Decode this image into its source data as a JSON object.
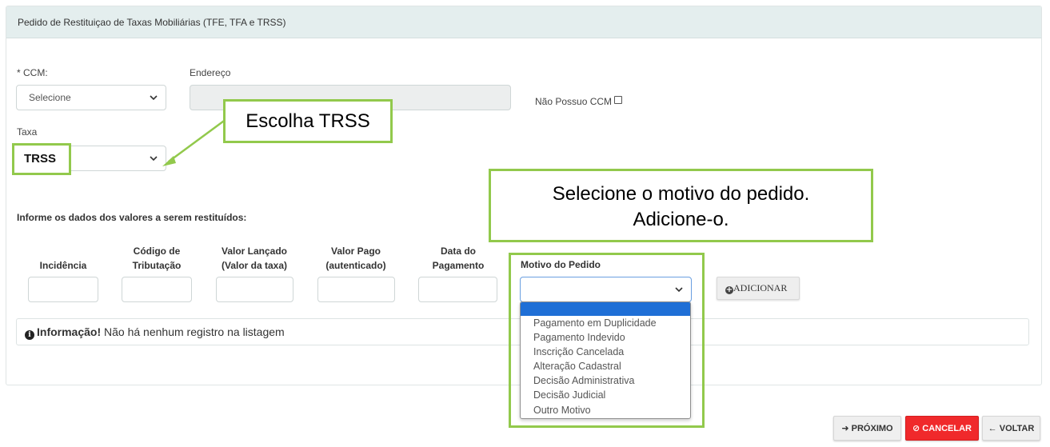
{
  "panel": {
    "title": "Pedido de Restituiçao de Taxas Mobiliárias (TFE, TFA e TRSS)"
  },
  "form": {
    "ccm_label": "* CCM:",
    "ccm_value": "Selecione",
    "endereco_label": "Endereço",
    "endereco_value": "",
    "nao_possuo_label": "Não Possuo CCM",
    "taxa_label": "Taxa",
    "taxa_value": "TRSS",
    "section_label": "Informe os dados dos valores a serem restituídos:",
    "columns": [
      {
        "line1": "",
        "line2": "Incidência"
      },
      {
        "line1": "Código de",
        "line2": "Tributação"
      },
      {
        "line1": "Valor Lançado",
        "line2": "(Valor da taxa)"
      },
      {
        "line1": "Valor Pago",
        "line2": "(autenticado)"
      },
      {
        "line1": "Data do",
        "line2": "Pagamento"
      }
    ],
    "motivo_label": "Motivo do Pedido",
    "motivo_value": "",
    "motivo_options": [
      "",
      "Pagamento em Duplicidade",
      "Pagamento Indevido",
      "Inscrição Cancelada",
      "Alteração Cadastral",
      "Decisão Administrativa",
      "Decisão Judicial",
      "Outro Motivo"
    ],
    "add_button": "ADICIONAR"
  },
  "info": {
    "strong": "Informação!",
    "text": " Não há nenhum registro na listagem"
  },
  "callouts": {
    "trss": "Escolha TRSS",
    "motivo_line1": "Selecione o motivo do pedido.",
    "motivo_line2": "Adicione-o."
  },
  "footer": {
    "next": "PRÓXIMO",
    "cancel": "CANCELAR",
    "back": "VOLTAR"
  },
  "colors": {
    "highlight": "#92c94c",
    "header_bg": "#e4eeee",
    "cancel_bg": "#f0292b",
    "selected_option": "#1f6fd6"
  }
}
